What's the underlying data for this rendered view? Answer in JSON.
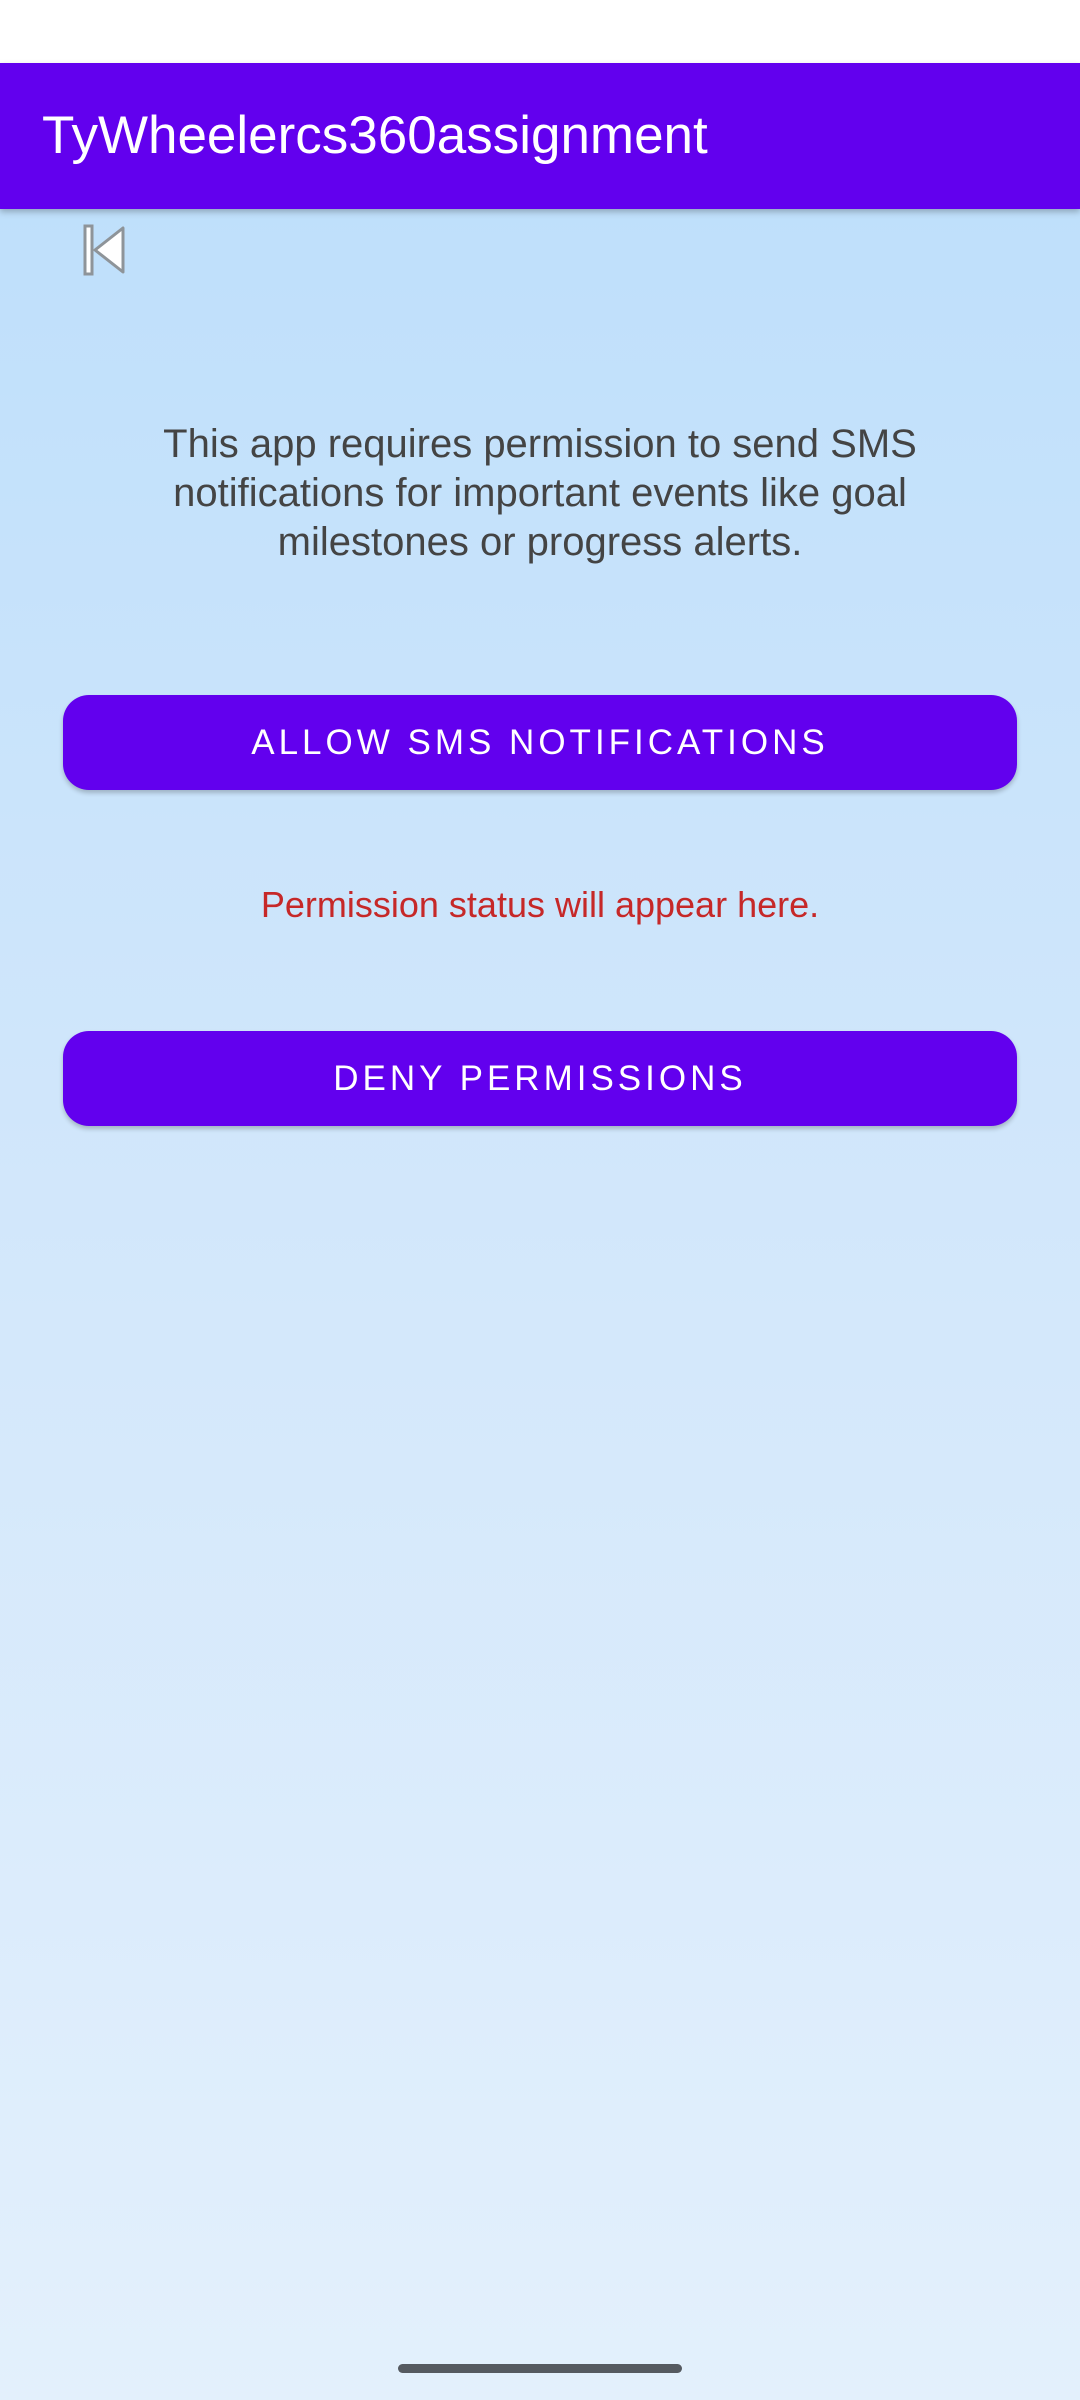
{
  "app_bar": {
    "title": "TyWheelercs360assignment"
  },
  "back_button": {
    "icon": "skip-previous-icon"
  },
  "content": {
    "description": "This app requires permission to send SMS notifications for important events like goal milestones or progress alerts.",
    "allow_button_label": "ALLOW SMS NOTIFICATIONS",
    "status_text": "Permission status will appear here.",
    "deny_button_label": "DENY PERMISSIONS"
  },
  "colors": {
    "primary": "#6200ee",
    "status_text": "#c62828",
    "background_top": "#bbdefb",
    "background_bottom": "#e3f0fc"
  }
}
